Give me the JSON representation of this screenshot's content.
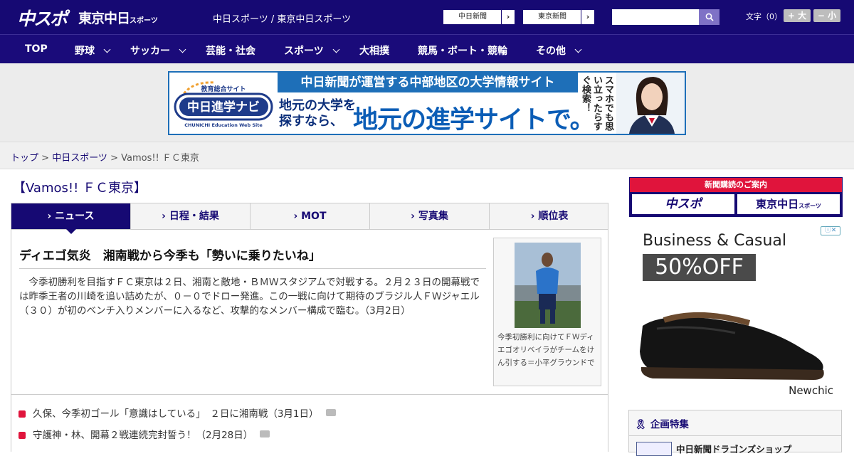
{
  "header": {
    "logo_main": "中スポ",
    "logo_sub": "東京中日",
    "logo_sub_small": "スポーツ",
    "tagline": "中日スポーツ / 東京中日スポーツ",
    "partner_links": [
      {
        "label": "中日新聞",
        "arrow": "›"
      },
      {
        "label": "東京新聞",
        "arrow": "›"
      }
    ],
    "search_placeholder": "",
    "font_size_label": "文字（0）",
    "font_plus": "+ 大",
    "font_minus": "− 小"
  },
  "nav": {
    "items": [
      {
        "label": "TOP",
        "dropdown": false
      },
      {
        "label": "野球",
        "dropdown": true
      },
      {
        "label": "サッカー",
        "dropdown": true
      },
      {
        "label": "芸能・社会",
        "dropdown": false
      },
      {
        "label": "スポーツ",
        "dropdown": true
      },
      {
        "label": "大相撲",
        "dropdown": false
      },
      {
        "label": "競馬・ボート・競輪",
        "dropdown": false
      },
      {
        "label": "その他",
        "dropdown": true
      }
    ]
  },
  "banner": {
    "logo_top": "教育総合サイト",
    "logo_main": "中日進学ナビ",
    "logo_en": "CHUNICHI Education Web Site",
    "line1": "中日新聞が運営する中部地区の大学情報サイト",
    "small": "地元の大学を\n探すなら、",
    "big": "地元の進学サイトで。",
    "vertical": "スマホでも思い立ったらすぐ検索！"
  },
  "breadcrumb": {
    "items": [
      "トップ",
      "中日スポーツ",
      "Vamos!! ＦＣ東京"
    ],
    "sep": " > "
  },
  "page_title": "【Vamos!! ＦＣ東京】",
  "tabs": [
    {
      "label": "› ニュース",
      "active": true
    },
    {
      "label": "› 日程・結果",
      "active": false
    },
    {
      "label": "› MOT",
      "active": false
    },
    {
      "label": "› 写真集",
      "active": false
    },
    {
      "label": "› 順位表",
      "active": false
    }
  ],
  "article": {
    "headline": "ディエゴ気炎　湘南戦から今季も「勢いに乗りたいね」",
    "body": "　今季初勝利を目指すＦＣ東京は２日、湘南と敵地・ＢＭＷスタジアムで対戦する。２月２３日の開幕戦では昨季王者の川崎を追い詰めたが、０－０でドロー発進。この一戦に向けて期待のブラジル人ＦＷジャエル（３０）が初のベンチ入りメンバーに入るなど、攻撃的なメンバー構成で臨む。（3月2日）",
    "photo_caption": "今季初勝利に向けてＦＷディエゴオリベイラがチームをけん引する＝小平グラウンドで"
  },
  "news_list": [
    {
      "text": "久保、今季初ゴール「意識はしている」　２日に湘南戦（3月1日）",
      "has_photo": true
    },
    {
      "text": "守護神・林、開幕２戦連続完封誓う！（2月28日）",
      "has_photo": true
    }
  ],
  "sidebar": {
    "subscribe": {
      "header": "新聞購読のご案内",
      "btn1": "中スポ",
      "btn2": "東京中日",
      "btn2_small": "スポーツ"
    },
    "ad": {
      "line1": "Business & Casual",
      "line2": "50%OFF",
      "brand": "Newchic",
      "info": "ⓘ✕"
    },
    "special": {
      "header": "企画特集",
      "first_item": "中日新聞ドラゴンズショップ"
    }
  },
  "colors": {
    "brand_navy": "#160973",
    "accent_red": "#e0143c",
    "banner_blue": "#1e6fb8"
  }
}
